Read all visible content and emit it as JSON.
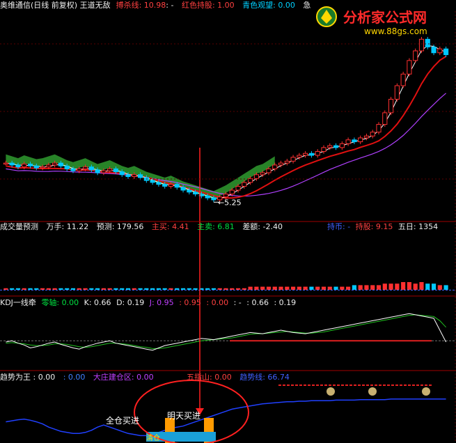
{
  "main_header": {
    "title": "奥维通信(日线 前复权) 王道无敌",
    "kill_line": "搏杀线: 10.98",
    "kill_suffix": ": -",
    "red_hold": "红色持股: 1.00",
    "cyan_watch": "青色观望: 0.00",
    "tail": "急"
  },
  "logo": {
    "name": "分析家公式网",
    "url": "www.88gs.com"
  },
  "volume_header": {
    "title": "成交量预测",
    "wanshou": "万手: 11.22",
    "forecast": "预测: 179.56",
    "main_buy": "主买: 4.41",
    "main_sell": "主卖: 6.81",
    "diff": "差额: -2.40",
    "right_a": "持币: -",
    "right_b": "持股: 9.15",
    "right_c": "五日: 1354"
  },
  "kdj_header": {
    "title": "KDJ一线牵",
    "zero": "零轴: 0.00",
    "k": "K: 0.66",
    "d": "D: 0.19",
    "j": "J: 0.95",
    "v1": ": 0.95",
    "v2": ": 0.00",
    "v3": ": -",
    "v4": ": 0.66",
    "v5": ": 0.19"
  },
  "trend_header": {
    "title": "趋势为王 : 0.00",
    "v1": ": 0.00",
    "dazhuang": "大庄建仓区: 0.00",
    "wuzhishan": "五指山: 0.00",
    "trend_line": "趋势线: 66.74"
  },
  "annotations": {
    "low_price": "5.25",
    "full_buy": "全仓买进",
    "buy_tomorrow": "明天买进",
    "bottom_text": "清仓"
  },
  "colors": {
    "up": "#ff3030",
    "down": "#00c8ff",
    "ma_white": "#ffffff",
    "ma_red": "#e01010",
    "ma_purple": "#b040ff",
    "band_green": "#2f9b2f",
    "band_red": "#c03030",
    "arrow": "#ff2020",
    "trend_blue": "#2040ff"
  },
  "chart_data": [
    {
      "type": "candlestick",
      "name": "main",
      "low_label": 5.25,
      "last_ma": 10.98,
      "closes": [
        7.2,
        7.1,
        7.0,
        7.15,
        7.05,
        6.95,
        7.0,
        7.1,
        7.2,
        7.05,
        6.9,
        6.8,
        6.9,
        7.0,
        6.85,
        6.7,
        6.8,
        6.9,
        6.75,
        6.6,
        6.5,
        6.6,
        6.45,
        6.3,
        6.2,
        6.1,
        6.0,
        6.1,
        5.95,
        5.8,
        5.7,
        5.6,
        5.5,
        5.4,
        5.3,
        5.45,
        5.6,
        5.8,
        6.0,
        6.2,
        6.4,
        6.6,
        6.7,
        6.9,
        7.1,
        7.2,
        7.3,
        7.5,
        7.6,
        7.7,
        7.6,
        7.8,
        8.0,
        8.1,
        8.0,
        8.2,
        8.4,
        8.3,
        8.5,
        8.6,
        8.8,
        9.2,
        9.8,
        10.5,
        11.2,
        11.8,
        12.5,
        13.0,
        13.6,
        13.2,
        12.9,
        13.1,
        12.8
      ]
    },
    {
      "type": "bar",
      "name": "volume",
      "values": [
        1,
        1,
        1,
        1,
        1,
        1,
        1,
        1,
        1,
        1,
        1,
        1,
        1,
        1,
        1,
        1,
        1,
        1,
        1,
        1,
        1,
        1,
        1,
        1,
        1,
        1,
        1,
        1,
        1,
        1,
        1,
        1,
        1,
        1,
        1,
        1,
        1,
        1,
        1,
        1,
        2,
        2,
        2,
        2,
        2,
        2,
        2,
        2,
        2,
        2,
        2,
        2,
        2,
        2,
        2,
        2,
        2,
        3,
        3,
        3,
        3,
        3,
        4,
        4,
        4,
        5,
        5,
        4,
        5,
        4,
        4,
        3,
        3
      ]
    },
    {
      "type": "line",
      "name": "kdj",
      "k": [
        40,
        42,
        38,
        35,
        30,
        32,
        35,
        38,
        40,
        36,
        33,
        30,
        28,
        32,
        35,
        38,
        40,
        42,
        38,
        36,
        34,
        32,
        30,
        28,
        26,
        30,
        34,
        36,
        38,
        40,
        42,
        44,
        46,
        45,
        44,
        46,
        48,
        50,
        52,
        54,
        56,
        55,
        54,
        56,
        58,
        60,
        58,
        56,
        55,
        54,
        56,
        58,
        60,
        62,
        64,
        66,
        68,
        70,
        72,
        74,
        76,
        78,
        80,
        82,
        84,
        86,
        88,
        86,
        84,
        82,
        80,
        60,
        40
      ],
      "d": [
        38,
        39,
        38,
        37,
        35,
        34,
        34,
        35,
        37,
        37,
        36,
        34,
        32,
        31,
        32,
        34,
        36,
        38,
        38,
        37,
        36,
        34,
        32,
        31,
        29,
        29,
        30,
        32,
        34,
        36,
        38,
        40,
        42,
        43,
        44,
        45,
        46,
        47,
        49,
        51,
        53,
        54,
        54,
        55,
        56,
        57,
        58,
        57,
        56,
        55,
        55,
        56,
        57,
        59,
        61,
        63,
        65,
        67,
        69,
        71,
        73,
        75,
        77,
        79,
        81,
        83,
        85,
        86,
        85,
        84,
        83,
        76,
        65
      ]
    },
    {
      "type": "line",
      "name": "trend",
      "values": [
        40,
        42,
        44,
        45,
        43,
        40,
        36,
        30,
        26,
        22,
        20,
        18,
        18,
        20,
        24,
        30,
        34,
        30,
        26,
        22,
        18,
        16,
        14,
        14,
        16,
        20,
        24,
        28,
        30,
        32,
        36,
        40,
        44,
        48,
        52,
        56,
        60,
        64,
        66,
        68,
        70,
        72,
        74,
        75,
        76,
        77,
        78,
        78,
        79,
        79,
        80,
        80,
        80,
        80,
        81,
        81,
        81,
        81,
        82,
        82,
        82,
        82,
        82,
        83,
        83,
        83,
        83,
        83,
        83,
        83,
        83,
        83,
        83
      ],
      "series_label": "趋势线",
      "last": 66.74
    }
  ]
}
